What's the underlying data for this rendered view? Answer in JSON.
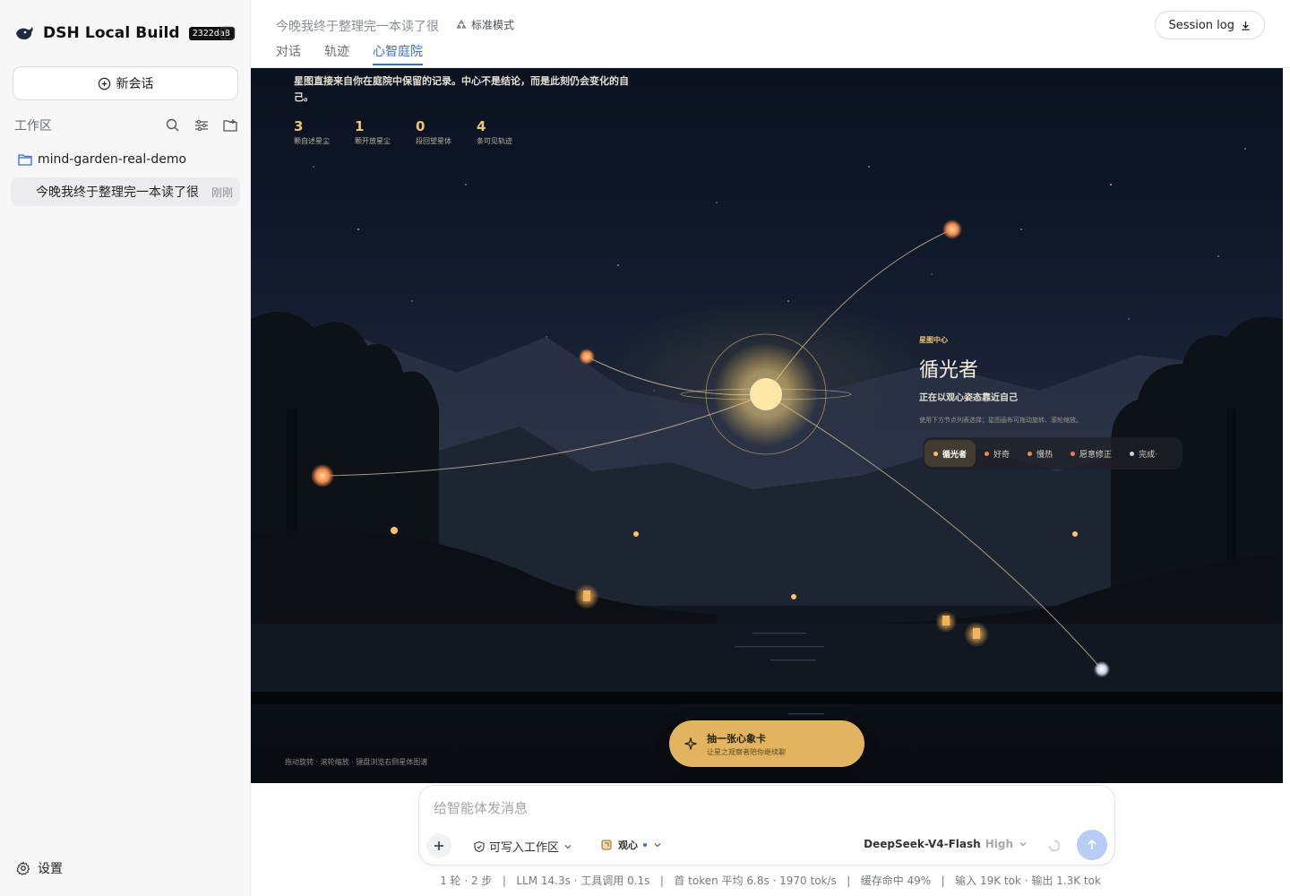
{
  "app": {
    "name": "DSH Local Build",
    "build_hash": "2322da8"
  },
  "sidebar": {
    "new_chat_label": "新会话",
    "workspace_title": "工作区",
    "folder_name": "mind-garden-real-demo",
    "sessions": [
      {
        "title": "今晚我终于整理完一本读了很",
        "time": "刚刚"
      }
    ],
    "settings_label": "设置"
  },
  "header": {
    "conversation_title": "今晚我终于整理完一本读了很",
    "mode_label": "标准模式",
    "tabs": [
      {
        "label": "对话"
      },
      {
        "label": "轨迹"
      },
      {
        "label": "心智庭院",
        "active": true
      }
    ],
    "session_log_label": "Session log"
  },
  "garden": {
    "description": "星图直接来自你在庭院中保留的记录。中心不是结论，而是此刻仍会变化的自己。",
    "stats": [
      {
        "value": "3",
        "label": "颗自述星尘"
      },
      {
        "value": "1",
        "label": "颗开放星尘"
      },
      {
        "value": "0",
        "label": "段回望星体"
      },
      {
        "value": "4",
        "label": "条可见轨迹"
      }
    ],
    "center_kicker": "星图中心",
    "center_name": "循光者",
    "center_subtitle": "正在以观心姿态靠近自己",
    "center_hint": "使用下方节点列表选择；星图画布可拖动旋转、滚轮缩放。",
    "nodes": [
      {
        "label": "循光者",
        "color": "#f0c472",
        "active": true
      },
      {
        "label": "好奇",
        "color": "#f08a4b"
      },
      {
        "label": "慢热",
        "color": "#f08a4b"
      },
      {
        "label": "愿意修正",
        "color": "#f07a5a"
      },
      {
        "label": "完成·",
        "color": "#c9d3e3"
      }
    ],
    "draw_card_title": "抽一张心象卡",
    "draw_card_subtitle": "让星之观察者陪你继续聊",
    "canvas_hint": "拖动旋转 · 滚轮缩放 · 键盘浏览右侧星体图谱"
  },
  "composer": {
    "placeholder": "给智能体发消息",
    "permission_label": "可写入工作区",
    "mind_mode_label": "观心",
    "model_name": "DeepSeek-V4-Flash",
    "model_level": "High"
  },
  "status_bar": "1 轮 · 2 步   |   LLM 14.3s · 工具调用 0.1s   |   首 token 平均 6.8s · 1970 tok/s   |   缓存命中 49%   |   输入 19K tok · 输出 1.3K tok",
  "colors": {
    "accent": "#3b6fd8",
    "gold": "#e2b45f",
    "star_core": "#ffe7a8"
  },
  "icons": [
    "whale-logo-icon",
    "sidebar-toggle-icon",
    "plus-circle-icon",
    "search-icon",
    "filter-icon",
    "new-folder-icon",
    "folder-icon",
    "gear-icon",
    "recycle-icon",
    "download-icon",
    "sparkle-icon",
    "plus-icon",
    "shield-icon",
    "chevron-down-icon",
    "cube-icon",
    "loading-icon",
    "arrow-up-icon"
  ]
}
